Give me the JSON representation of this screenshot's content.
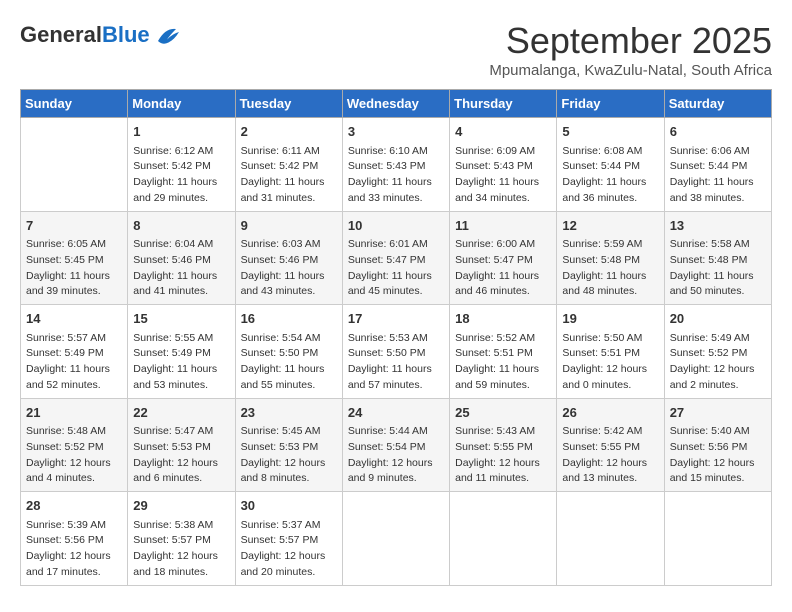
{
  "header": {
    "logo_general": "General",
    "logo_blue": "Blue",
    "month_title": "September 2025",
    "location": "Mpumalanga, KwaZulu-Natal, South Africa"
  },
  "days_of_week": [
    "Sunday",
    "Monday",
    "Tuesday",
    "Wednesday",
    "Thursday",
    "Friday",
    "Saturday"
  ],
  "weeks": [
    [
      {
        "day": "",
        "sunrise": "",
        "sunset": "",
        "daylight": ""
      },
      {
        "day": "1",
        "sunrise": "Sunrise: 6:12 AM",
        "sunset": "Sunset: 5:42 PM",
        "daylight": "Daylight: 11 hours and 29 minutes."
      },
      {
        "day": "2",
        "sunrise": "Sunrise: 6:11 AM",
        "sunset": "Sunset: 5:42 PM",
        "daylight": "Daylight: 11 hours and 31 minutes."
      },
      {
        "day": "3",
        "sunrise": "Sunrise: 6:10 AM",
        "sunset": "Sunset: 5:43 PM",
        "daylight": "Daylight: 11 hours and 33 minutes."
      },
      {
        "day": "4",
        "sunrise": "Sunrise: 6:09 AM",
        "sunset": "Sunset: 5:43 PM",
        "daylight": "Daylight: 11 hours and 34 minutes."
      },
      {
        "day": "5",
        "sunrise": "Sunrise: 6:08 AM",
        "sunset": "Sunset: 5:44 PM",
        "daylight": "Daylight: 11 hours and 36 minutes."
      },
      {
        "day": "6",
        "sunrise": "Sunrise: 6:06 AM",
        "sunset": "Sunset: 5:44 PM",
        "daylight": "Daylight: 11 hours and 38 minutes."
      }
    ],
    [
      {
        "day": "7",
        "sunrise": "Sunrise: 6:05 AM",
        "sunset": "Sunset: 5:45 PM",
        "daylight": "Daylight: 11 hours and 39 minutes."
      },
      {
        "day": "8",
        "sunrise": "Sunrise: 6:04 AM",
        "sunset": "Sunset: 5:46 PM",
        "daylight": "Daylight: 11 hours and 41 minutes."
      },
      {
        "day": "9",
        "sunrise": "Sunrise: 6:03 AM",
        "sunset": "Sunset: 5:46 PM",
        "daylight": "Daylight: 11 hours and 43 minutes."
      },
      {
        "day": "10",
        "sunrise": "Sunrise: 6:01 AM",
        "sunset": "Sunset: 5:47 PM",
        "daylight": "Daylight: 11 hours and 45 minutes."
      },
      {
        "day": "11",
        "sunrise": "Sunrise: 6:00 AM",
        "sunset": "Sunset: 5:47 PM",
        "daylight": "Daylight: 11 hours and 46 minutes."
      },
      {
        "day": "12",
        "sunrise": "Sunrise: 5:59 AM",
        "sunset": "Sunset: 5:48 PM",
        "daylight": "Daylight: 11 hours and 48 minutes."
      },
      {
        "day": "13",
        "sunrise": "Sunrise: 5:58 AM",
        "sunset": "Sunset: 5:48 PM",
        "daylight": "Daylight: 11 hours and 50 minutes."
      }
    ],
    [
      {
        "day": "14",
        "sunrise": "Sunrise: 5:57 AM",
        "sunset": "Sunset: 5:49 PM",
        "daylight": "Daylight: 11 hours and 52 minutes."
      },
      {
        "day": "15",
        "sunrise": "Sunrise: 5:55 AM",
        "sunset": "Sunset: 5:49 PM",
        "daylight": "Daylight: 11 hours and 53 minutes."
      },
      {
        "day": "16",
        "sunrise": "Sunrise: 5:54 AM",
        "sunset": "Sunset: 5:50 PM",
        "daylight": "Daylight: 11 hours and 55 minutes."
      },
      {
        "day": "17",
        "sunrise": "Sunrise: 5:53 AM",
        "sunset": "Sunset: 5:50 PM",
        "daylight": "Daylight: 11 hours and 57 minutes."
      },
      {
        "day": "18",
        "sunrise": "Sunrise: 5:52 AM",
        "sunset": "Sunset: 5:51 PM",
        "daylight": "Daylight: 11 hours and 59 minutes."
      },
      {
        "day": "19",
        "sunrise": "Sunrise: 5:50 AM",
        "sunset": "Sunset: 5:51 PM",
        "daylight": "Daylight: 12 hours and 0 minutes."
      },
      {
        "day": "20",
        "sunrise": "Sunrise: 5:49 AM",
        "sunset": "Sunset: 5:52 PM",
        "daylight": "Daylight: 12 hours and 2 minutes."
      }
    ],
    [
      {
        "day": "21",
        "sunrise": "Sunrise: 5:48 AM",
        "sunset": "Sunset: 5:52 PM",
        "daylight": "Daylight: 12 hours and 4 minutes."
      },
      {
        "day": "22",
        "sunrise": "Sunrise: 5:47 AM",
        "sunset": "Sunset: 5:53 PM",
        "daylight": "Daylight: 12 hours and 6 minutes."
      },
      {
        "day": "23",
        "sunrise": "Sunrise: 5:45 AM",
        "sunset": "Sunset: 5:53 PM",
        "daylight": "Daylight: 12 hours and 8 minutes."
      },
      {
        "day": "24",
        "sunrise": "Sunrise: 5:44 AM",
        "sunset": "Sunset: 5:54 PM",
        "daylight": "Daylight: 12 hours and 9 minutes."
      },
      {
        "day": "25",
        "sunrise": "Sunrise: 5:43 AM",
        "sunset": "Sunset: 5:55 PM",
        "daylight": "Daylight: 12 hours and 11 minutes."
      },
      {
        "day": "26",
        "sunrise": "Sunrise: 5:42 AM",
        "sunset": "Sunset: 5:55 PM",
        "daylight": "Daylight: 12 hours and 13 minutes."
      },
      {
        "day": "27",
        "sunrise": "Sunrise: 5:40 AM",
        "sunset": "Sunset: 5:56 PM",
        "daylight": "Daylight: 12 hours and 15 minutes."
      }
    ],
    [
      {
        "day": "28",
        "sunrise": "Sunrise: 5:39 AM",
        "sunset": "Sunset: 5:56 PM",
        "daylight": "Daylight: 12 hours and 17 minutes."
      },
      {
        "day": "29",
        "sunrise": "Sunrise: 5:38 AM",
        "sunset": "Sunset: 5:57 PM",
        "daylight": "Daylight: 12 hours and 18 minutes."
      },
      {
        "day": "30",
        "sunrise": "Sunrise: 5:37 AM",
        "sunset": "Sunset: 5:57 PM",
        "daylight": "Daylight: 12 hours and 20 minutes."
      },
      {
        "day": "",
        "sunrise": "",
        "sunset": "",
        "daylight": ""
      },
      {
        "day": "",
        "sunrise": "",
        "sunset": "",
        "daylight": ""
      },
      {
        "day": "",
        "sunrise": "",
        "sunset": "",
        "daylight": ""
      },
      {
        "day": "",
        "sunrise": "",
        "sunset": "",
        "daylight": ""
      }
    ]
  ]
}
